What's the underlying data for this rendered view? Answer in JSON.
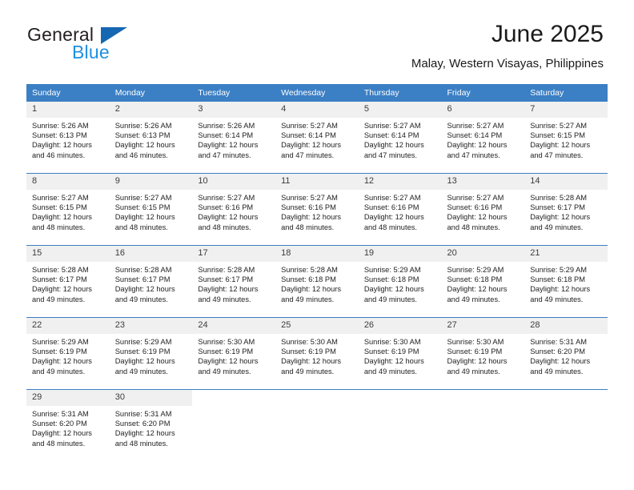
{
  "brand": {
    "name_top": "General",
    "name_bottom": "Blue",
    "triangle_icon": "triangle-logo-icon",
    "accent_blue": "#1f8fe0",
    "triangle_blue": "#1567b2"
  },
  "header": {
    "title": "June 2025",
    "subtitle": "Malay, Western Visayas, Philippines"
  },
  "theme": {
    "header_blue": "#3b7fc4",
    "daynum_bg": "#f0f0f0",
    "text": "#222222"
  },
  "calendar": {
    "weekday_headers": [
      "Sunday",
      "Monday",
      "Tuesday",
      "Wednesday",
      "Thursday",
      "Friday",
      "Saturday"
    ],
    "weeks": [
      [
        {
          "day": "1",
          "sunrise": "Sunrise: 5:26 AM",
          "sunset": "Sunset: 6:13 PM",
          "daylight": "Daylight: 12 hours and 46 minutes."
        },
        {
          "day": "2",
          "sunrise": "Sunrise: 5:26 AM",
          "sunset": "Sunset: 6:13 PM",
          "daylight": "Daylight: 12 hours and 46 minutes."
        },
        {
          "day": "3",
          "sunrise": "Sunrise: 5:26 AM",
          "sunset": "Sunset: 6:14 PM",
          "daylight": "Daylight: 12 hours and 47 minutes."
        },
        {
          "day": "4",
          "sunrise": "Sunrise: 5:27 AM",
          "sunset": "Sunset: 6:14 PM",
          "daylight": "Daylight: 12 hours and 47 minutes."
        },
        {
          "day": "5",
          "sunrise": "Sunrise: 5:27 AM",
          "sunset": "Sunset: 6:14 PM",
          "daylight": "Daylight: 12 hours and 47 minutes."
        },
        {
          "day": "6",
          "sunrise": "Sunrise: 5:27 AM",
          "sunset": "Sunset: 6:14 PM",
          "daylight": "Daylight: 12 hours and 47 minutes."
        },
        {
          "day": "7",
          "sunrise": "Sunrise: 5:27 AM",
          "sunset": "Sunset: 6:15 PM",
          "daylight": "Daylight: 12 hours and 47 minutes."
        }
      ],
      [
        {
          "day": "8",
          "sunrise": "Sunrise: 5:27 AM",
          "sunset": "Sunset: 6:15 PM",
          "daylight": "Daylight: 12 hours and 48 minutes."
        },
        {
          "day": "9",
          "sunrise": "Sunrise: 5:27 AM",
          "sunset": "Sunset: 6:15 PM",
          "daylight": "Daylight: 12 hours and 48 minutes."
        },
        {
          "day": "10",
          "sunrise": "Sunrise: 5:27 AM",
          "sunset": "Sunset: 6:16 PM",
          "daylight": "Daylight: 12 hours and 48 minutes."
        },
        {
          "day": "11",
          "sunrise": "Sunrise: 5:27 AM",
          "sunset": "Sunset: 6:16 PM",
          "daylight": "Daylight: 12 hours and 48 minutes."
        },
        {
          "day": "12",
          "sunrise": "Sunrise: 5:27 AM",
          "sunset": "Sunset: 6:16 PM",
          "daylight": "Daylight: 12 hours and 48 minutes."
        },
        {
          "day": "13",
          "sunrise": "Sunrise: 5:27 AM",
          "sunset": "Sunset: 6:16 PM",
          "daylight": "Daylight: 12 hours and 48 minutes."
        },
        {
          "day": "14",
          "sunrise": "Sunrise: 5:28 AM",
          "sunset": "Sunset: 6:17 PM",
          "daylight": "Daylight: 12 hours and 49 minutes."
        }
      ],
      [
        {
          "day": "15",
          "sunrise": "Sunrise: 5:28 AM",
          "sunset": "Sunset: 6:17 PM",
          "daylight": "Daylight: 12 hours and 49 minutes."
        },
        {
          "day": "16",
          "sunrise": "Sunrise: 5:28 AM",
          "sunset": "Sunset: 6:17 PM",
          "daylight": "Daylight: 12 hours and 49 minutes."
        },
        {
          "day": "17",
          "sunrise": "Sunrise: 5:28 AM",
          "sunset": "Sunset: 6:17 PM",
          "daylight": "Daylight: 12 hours and 49 minutes."
        },
        {
          "day": "18",
          "sunrise": "Sunrise: 5:28 AM",
          "sunset": "Sunset: 6:18 PM",
          "daylight": "Daylight: 12 hours and 49 minutes."
        },
        {
          "day": "19",
          "sunrise": "Sunrise: 5:29 AM",
          "sunset": "Sunset: 6:18 PM",
          "daylight": "Daylight: 12 hours and 49 minutes."
        },
        {
          "day": "20",
          "sunrise": "Sunrise: 5:29 AM",
          "sunset": "Sunset: 6:18 PM",
          "daylight": "Daylight: 12 hours and 49 minutes."
        },
        {
          "day": "21",
          "sunrise": "Sunrise: 5:29 AM",
          "sunset": "Sunset: 6:18 PM",
          "daylight": "Daylight: 12 hours and 49 minutes."
        }
      ],
      [
        {
          "day": "22",
          "sunrise": "Sunrise: 5:29 AM",
          "sunset": "Sunset: 6:19 PM",
          "daylight": "Daylight: 12 hours and 49 minutes."
        },
        {
          "day": "23",
          "sunrise": "Sunrise: 5:29 AM",
          "sunset": "Sunset: 6:19 PM",
          "daylight": "Daylight: 12 hours and 49 minutes."
        },
        {
          "day": "24",
          "sunrise": "Sunrise: 5:30 AM",
          "sunset": "Sunset: 6:19 PM",
          "daylight": "Daylight: 12 hours and 49 minutes."
        },
        {
          "day": "25",
          "sunrise": "Sunrise: 5:30 AM",
          "sunset": "Sunset: 6:19 PM",
          "daylight": "Daylight: 12 hours and 49 minutes."
        },
        {
          "day": "26",
          "sunrise": "Sunrise: 5:30 AM",
          "sunset": "Sunset: 6:19 PM",
          "daylight": "Daylight: 12 hours and 49 minutes."
        },
        {
          "day": "27",
          "sunrise": "Sunrise: 5:30 AM",
          "sunset": "Sunset: 6:19 PM",
          "daylight": "Daylight: 12 hours and 49 minutes."
        },
        {
          "day": "28",
          "sunrise": "Sunrise: 5:31 AM",
          "sunset": "Sunset: 6:20 PM",
          "daylight": "Daylight: 12 hours and 49 minutes."
        }
      ],
      [
        {
          "day": "29",
          "sunrise": "Sunrise: 5:31 AM",
          "sunset": "Sunset: 6:20 PM",
          "daylight": "Daylight: 12 hours and 48 minutes."
        },
        {
          "day": "30",
          "sunrise": "Sunrise: 5:31 AM",
          "sunset": "Sunset: 6:20 PM",
          "daylight": "Daylight: 12 hours and 48 minutes."
        },
        null,
        null,
        null,
        null,
        null
      ]
    ]
  }
}
